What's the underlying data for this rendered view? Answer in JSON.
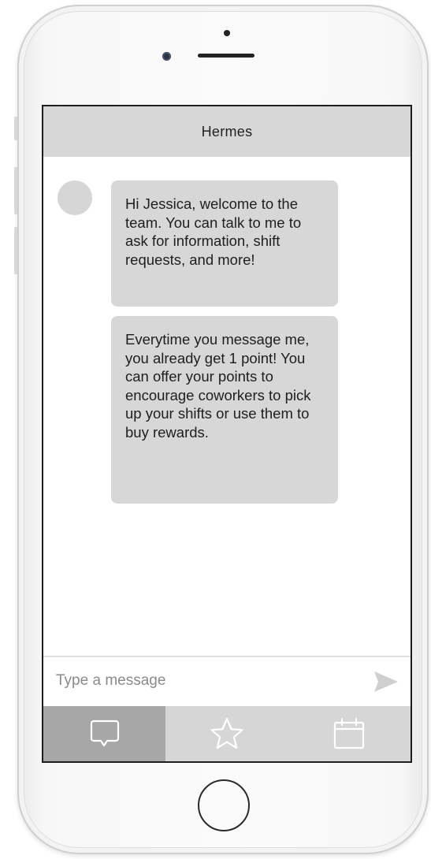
{
  "app": {
    "title": "Hermes"
  },
  "chat": {
    "messages": [
      {
        "sender": "bot",
        "text": "Hi Jessica, welcome to the team. You can talk to me to ask for information, shift requests, and more!"
      },
      {
        "sender": "bot",
        "text": "Everytime you message me, you already get 1 point! You can offer your points to encourage coworkers to pick up your shifts or use them to buy rewards."
      }
    ]
  },
  "composer": {
    "placeholder": "Type a message",
    "value": "",
    "send_icon": "send-arrow-icon"
  },
  "tabs": [
    {
      "icon": "chat-bubble-icon",
      "active": true
    },
    {
      "icon": "star-icon",
      "active": false
    },
    {
      "icon": "calendar-icon",
      "active": false
    }
  ],
  "colors": {
    "header_bg": "#d7d7d7",
    "bubble_bg": "#d7d7d7",
    "active_tab_bg": "#a7a7a7",
    "inactive_tab_bg": "#d6d6d6"
  }
}
